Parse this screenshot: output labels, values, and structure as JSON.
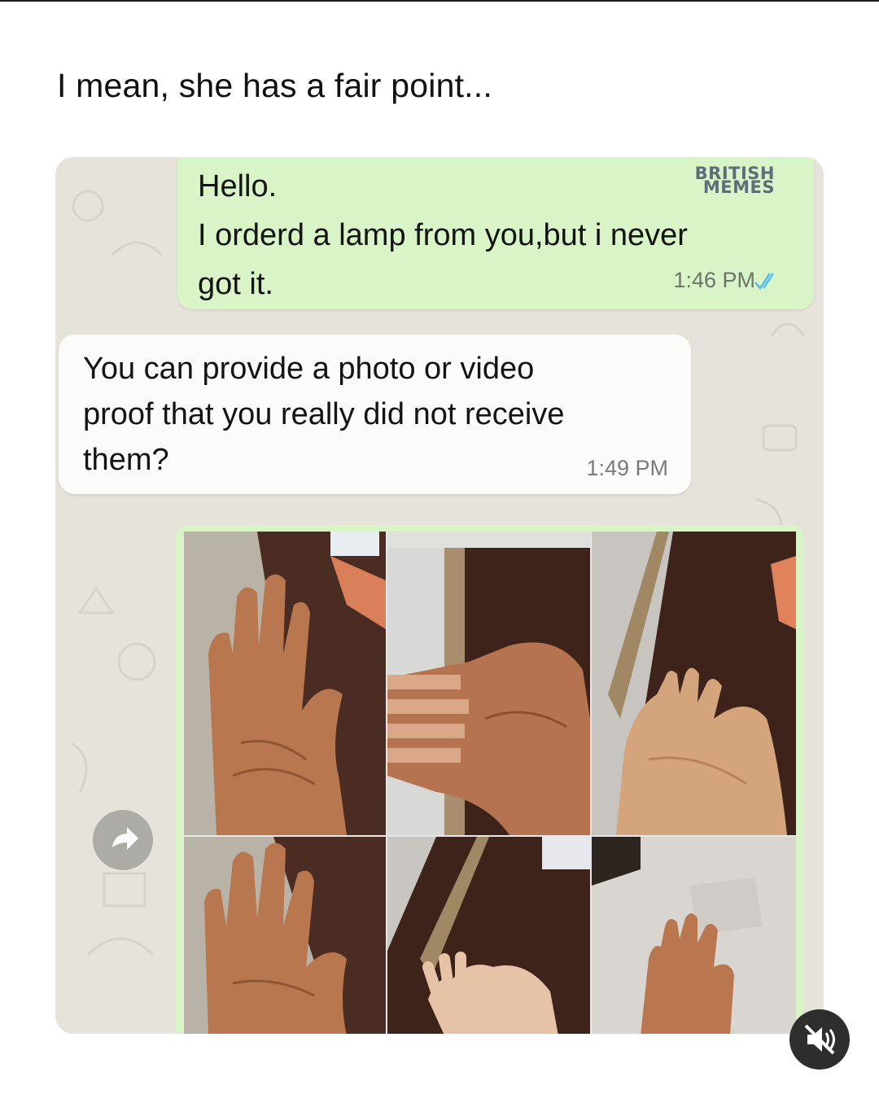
{
  "post": {
    "caption": "I mean, she has a fair point..."
  },
  "chat": {
    "messages": [
      {
        "direction": "outgoing",
        "lines": [
          "Hello.",
          "I orderd a lamp from you,but i never",
          "got it."
        ],
        "time": "1:46 PM",
        "status": "read",
        "status_color": "#53bdeb"
      },
      {
        "direction": "incoming",
        "lines": [
          "You can provide a photo or video",
          "proof that you really did not receive",
          "them?"
        ],
        "time": "1:49 PM"
      }
    ],
    "photo_message": {
      "photo_count": 6,
      "description_icons": [
        "open-palm-photo"
      ]
    },
    "colors": {
      "outgoing_bubble": "#d9f5c7",
      "incoming_bubble": "#fbfbf9",
      "chat_background": "#e6e3db"
    }
  },
  "watermark": {
    "line1": "BRITISH",
    "line2": "MEMES"
  },
  "controls": {
    "forward_icon": "forward-arrow-icon",
    "mute_icon": "speaker-muted-icon"
  }
}
